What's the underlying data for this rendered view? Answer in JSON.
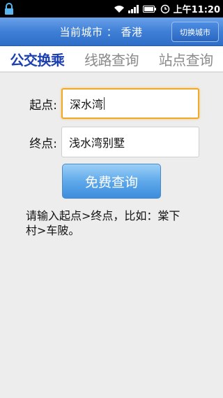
{
  "status_bar": {
    "time": "上午11:20"
  },
  "header": {
    "city_label": "当前城市 ： 香港",
    "switch_city_label": "切换城市"
  },
  "tabs": [
    {
      "label": "公交换乘",
      "active": true
    },
    {
      "label": "线路查询",
      "active": false
    },
    {
      "label": "站点查询",
      "active": false
    }
  ],
  "form": {
    "start_label": "起点:",
    "start_value": "深水湾",
    "end_label": "终点:",
    "end_value": "浅水湾别墅"
  },
  "query_button_label": "免费查询",
  "hint": "请输入起点>终点，比如：棠下村>车陂。",
  "colors": {
    "title_bar": "#3f7fd6",
    "active_tab": "#1c3fb0",
    "focus_border": "#f0a92a"
  }
}
